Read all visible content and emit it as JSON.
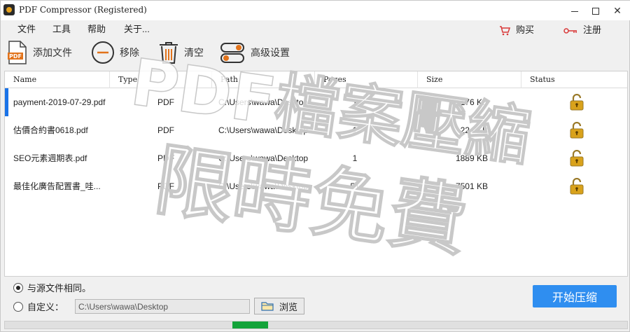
{
  "window": {
    "title": "PDF Compressor (Registered)"
  },
  "menu": {
    "file": "文件",
    "tools": "工具",
    "help": "帮助",
    "about": "关于..."
  },
  "actions": {
    "buy": "购买",
    "register": "注册"
  },
  "toolbar": {
    "add_files": "添加文件",
    "remove": "移除",
    "clear": "清空",
    "advanced": "高级设置"
  },
  "table": {
    "columns": [
      "Name",
      "Type",
      "Path",
      "Pages",
      "Size",
      "Status"
    ],
    "rows": [
      {
        "name": "payment-2019-07-29.pdf",
        "type": "PDF",
        "path": "C:\\Users\\wawa\\Desktop",
        "pages": "1",
        "size": "176 KB"
      },
      {
        "name": "估價合約書0618.pdf",
        "type": "PDF",
        "path": "C:\\Users\\wawa\\Desktop",
        "pages": "1",
        "size": "224 KB"
      },
      {
        "name": "SEO元素週期表.pdf",
        "type": "PDF",
        "path": "C:\\Users\\wawa\\Desktop",
        "pages": "1",
        "size": "1889 KB"
      },
      {
        "name": "最佳化廣告配置書_哇...",
        "type": "PDF",
        "path": "C:\\Users\\wawa\\Desktop",
        "pages": "51",
        "size": "7501 KB"
      }
    ]
  },
  "watermark": {
    "line1": "PDF檔案壓縮",
    "line2": "限時免費"
  },
  "output": {
    "same_as_source": "与源文件相同。",
    "custom": "自定义：",
    "custom_path": "C:\\Users\\wawa\\Desktop",
    "browse": "浏览"
  },
  "start": {
    "label": "开始压缩"
  },
  "progress": {
    "fill_start": 0.366,
    "fill_end": 0.423
  },
  "colors": {
    "accent": "#2f8ef0",
    "progress": "#14a33a",
    "lock": "#d9a21b",
    "cart": "#d93838"
  },
  "icons": {
    "add": "pdf-file-icon",
    "remove": "minus-circle-icon",
    "clear": "trash-icon",
    "advanced": "toggle-icon",
    "status": "lock-open-icon"
  }
}
